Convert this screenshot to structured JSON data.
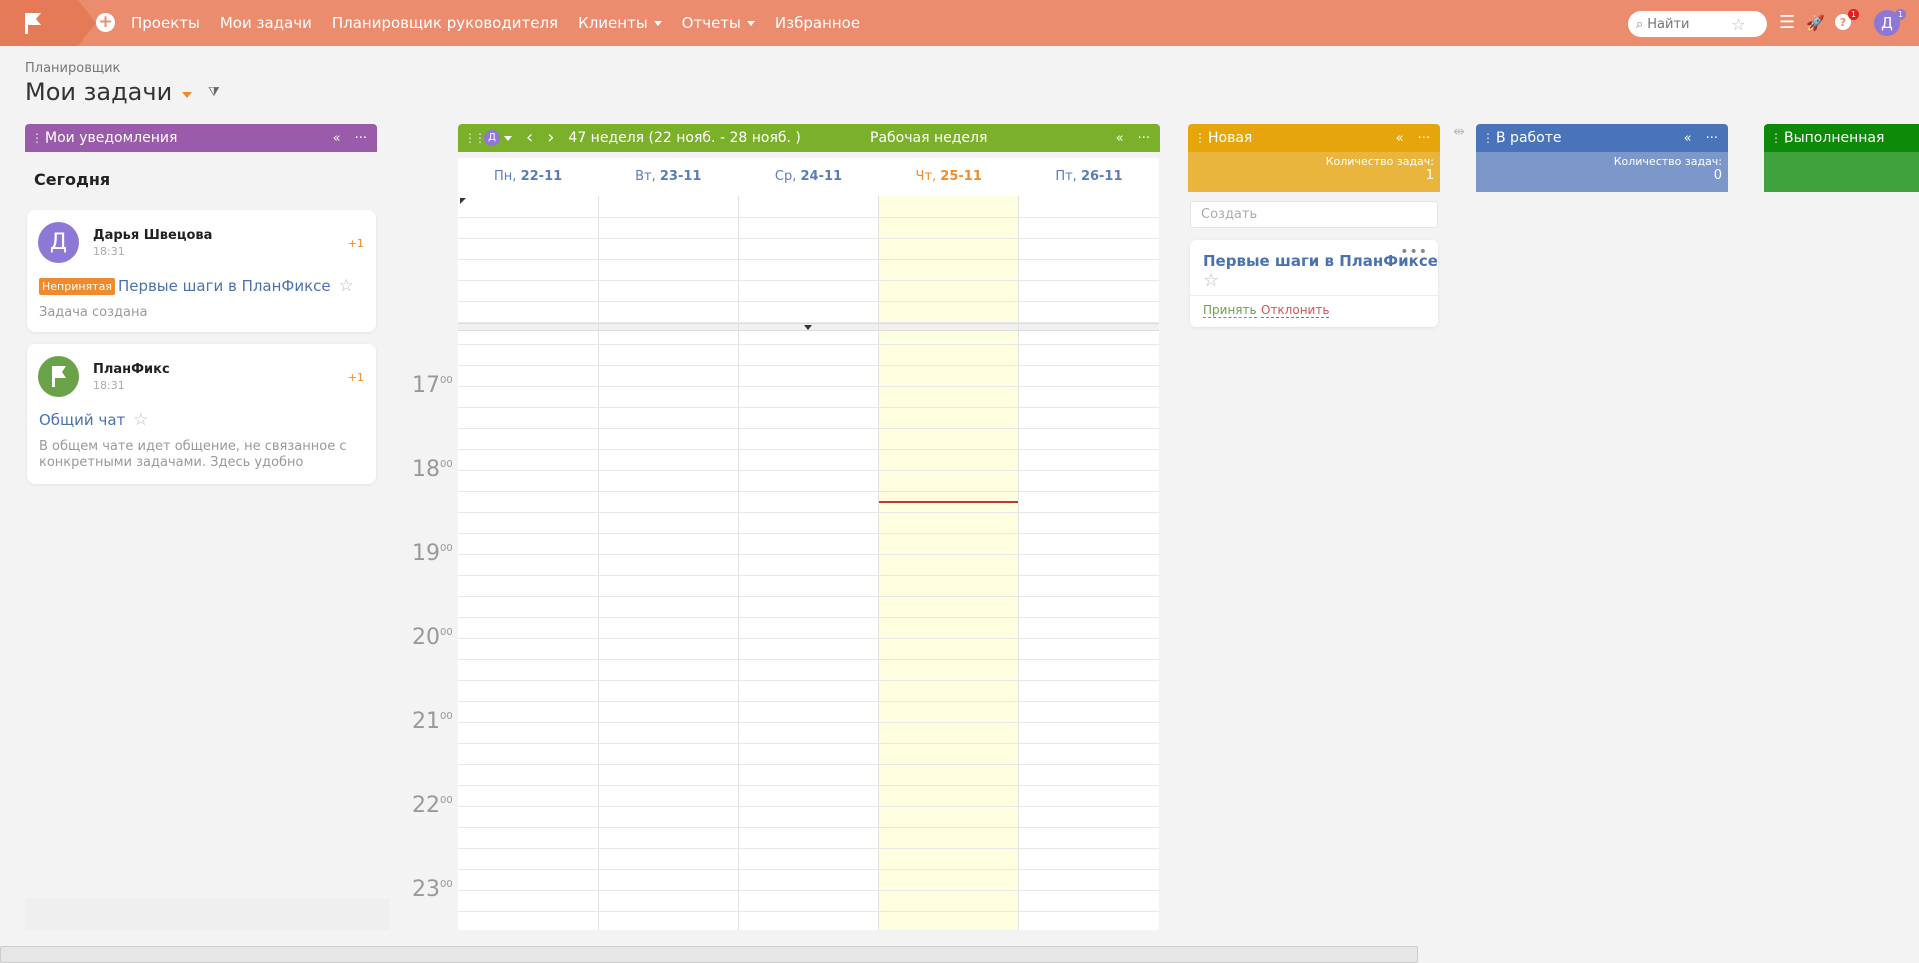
{
  "topbar": {
    "nav": [
      {
        "label": "Проекты",
        "dropdown": false
      },
      {
        "label": "Мои задачи",
        "dropdown": false
      },
      {
        "label": "Планировщик руководителя",
        "dropdown": false
      },
      {
        "label": "Клиенты",
        "dropdown": true
      },
      {
        "label": "Отчеты",
        "dropdown": true
      },
      {
        "label": "Избранное",
        "dropdown": false
      }
    ],
    "search_placeholder": "Найти",
    "help_badge": "1",
    "user_initial": "Д",
    "user_badge": "1",
    "accent_color": "#ea8c6d"
  },
  "page": {
    "breadcrumb": "Планировщик",
    "title": "Мои задачи"
  },
  "notifications": {
    "header": "Мои уведомления",
    "today_label": "Сегодня",
    "items": [
      {
        "author": "Дарья Швецова",
        "initial": "Д",
        "time": "18:31",
        "counter": "+1",
        "tag": "Непринятая",
        "link": "Первые шаги в ПланФиксе",
        "description": "Задача создана"
      },
      {
        "author": "ПланФикс",
        "time": "18:31",
        "counter": "+1",
        "link": "Общий чат",
        "description": "В общем чате идет общение, не связанное с конкретными задачами. Здесь удобно"
      }
    ]
  },
  "calendar": {
    "user_initial": "Д",
    "week_label": "47 неделя  (22 нояб. - 28 нояб. )",
    "view_label": "Рабочая неделя",
    "days": [
      {
        "name": "Пн,",
        "date": "22-11"
      },
      {
        "name": "Вт,",
        "date": "23-11"
      },
      {
        "name": "Ср,",
        "date": "24-11"
      },
      {
        "name": "Чт,",
        "date": "25-11"
      },
      {
        "name": "Пт,",
        "date": "26-11"
      }
    ],
    "today_index": 3,
    "hours": [
      "17",
      "18",
      "19",
      "20",
      "21",
      "22",
      "23"
    ],
    "minutes_suffix": "00"
  },
  "kanban": {
    "count_label": "Количество задач:",
    "columns": [
      {
        "title": "Новая",
        "count": "1",
        "color": "#e6a50a"
      },
      {
        "title": "В работе",
        "count": "0",
        "color": "#4a74b9"
      },
      {
        "title": "Выполненная",
        "count": "",
        "color": "#0c8a08"
      }
    ],
    "create_placeholder": "Создать",
    "task": {
      "title": "Первые шаги в ПланФиксе",
      "accept": "Принять",
      "decline": "Отклонить"
    }
  }
}
